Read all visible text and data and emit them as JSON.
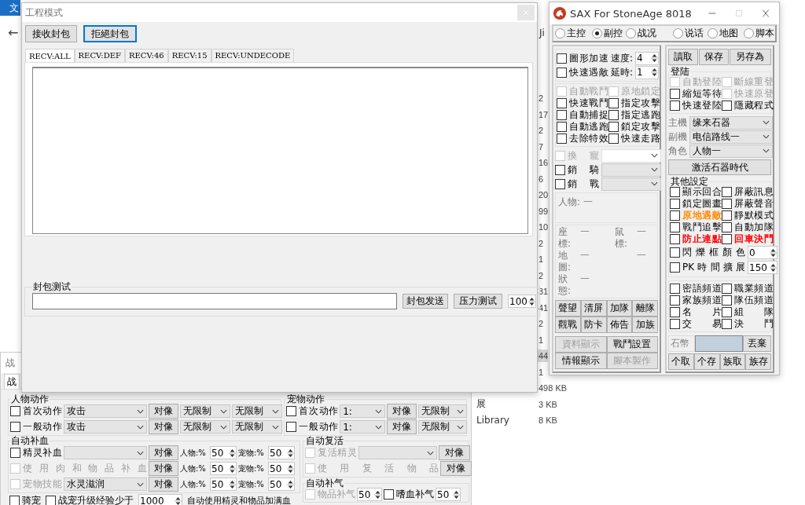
{
  "explorer": {
    "tab": "文",
    "back": "←",
    "column_head": "Ji",
    "rows": [
      {
        "size": "2",
        "selected": false
      },
      {
        "size": "17",
        "selected": false
      },
      {
        "size": "2",
        "selected": false
      },
      {
        "size": "7",
        "selected": false
      },
      {
        "size": "16",
        "selected": false
      },
      {
        "size": "6",
        "selected": false
      },
      {
        "size": "20",
        "selected": false
      },
      {
        "size": "99",
        "selected": false
      },
      {
        "size": "10",
        "selected": false
      },
      {
        "size": "2",
        "selected": false
      },
      {
        "size": "1",
        "selected": false
      },
      {
        "size": "2",
        "selected": false
      },
      {
        "size": "31",
        "selected": false
      },
      {
        "size": "41",
        "selected": false
      },
      {
        "size": "2",
        "selected": false
      },
      {
        "size": "1",
        "selected": false
      },
      {
        "size": "44",
        "selected": true
      },
      {
        "size": "1",
        "selected": false
      },
      {
        "size": "498 KB",
        "selected": false
      },
      {
        "name": "展",
        "size": "3 KB",
        "selected": false
      },
      {
        "name": "Library",
        "size": "8 KB",
        "selected": false
      }
    ]
  },
  "battle_window": {
    "title": "战",
    "tab": "战",
    "char_group": {
      "title": "人物动作",
      "rows": [
        {
          "label": "首次动作",
          "checked": false,
          "action": "攻击",
          "target": "对像",
          "limit_1": "无限制",
          "limit_2": "无限制"
        },
        {
          "label": "一般动作",
          "checked": false,
          "action": "攻击",
          "target": "对像",
          "limit_1": "无限制",
          "limit_2": "无限制"
        }
      ]
    },
    "pet_group": {
      "title": "宠物动作",
      "rows": [
        {
          "label": "首次动作",
          "checked": false,
          "action": "1:",
          "target": "对像",
          "limit": "无限制"
        },
        {
          "label": "一般动作",
          "checked": false,
          "action": "1:",
          "target": "对像",
          "limit": "无限制"
        }
      ]
    },
    "heal_group": {
      "title": "自动补血",
      "rows": [
        {
          "kind": "select",
          "label": "精灵补血",
          "checked": false,
          "disabled": false,
          "target": "对像",
          "char_label": "人物:%",
          "char_value": "50",
          "pet_label": "宠物:%",
          "pet_value": "50"
        },
        {
          "kind": "plain",
          "label": "使用肉和物品补血",
          "checked": false,
          "disabled": true,
          "target": "对像",
          "char_label": "人物:%",
          "char_value": "50",
          "pet_label": "宠物:%",
          "pet_value": "50"
        },
        {
          "kind": "select",
          "label": "宠物技能",
          "value": "水灵滋润",
          "checked": false,
          "disabled": true,
          "target": "对像",
          "char_label": "人物:%",
          "char_value": "50",
          "pet_label": "宠物:%",
          "pet_value": "50"
        }
      ]
    },
    "revive_group": {
      "title": "自动复活",
      "rows": [
        {
          "kind": "select",
          "label": "复活精灵",
          "checked": false,
          "disabled": true,
          "target": "对像"
        },
        {
          "kind": "plain",
          "label": "使用复活物品",
          "checked": false,
          "disabled": true,
          "target": "对像"
        }
      ]
    },
    "mp_group": {
      "title": "自动补气",
      "items": [
        {
          "label": "物品补气",
          "checked": false,
          "disabled": true,
          "value": "50"
        },
        {
          "label": "嗜血补气",
          "checked": false,
          "disabled": false,
          "value": "50"
        }
      ]
    },
    "ride": {
      "label": "骑宠",
      "checked": false
    },
    "exp": {
      "label": "战宠升级经验少于",
      "checked": false,
      "value": "1000",
      "note": "自动使用精灵和物品加满血"
    }
  },
  "packet_window": {
    "title": "工程模式",
    "buttons": [
      {
        "label": "接收封包",
        "focused": false
      },
      {
        "label": "拒絕封包",
        "focused": true
      }
    ],
    "tabs": [
      {
        "label": "RECV:ALL",
        "selected": true
      },
      {
        "label": "RECV:DEF",
        "selected": false
      },
      {
        "label": "RECV:46",
        "selected": false
      },
      {
        "label": "RECV:15",
        "selected": false
      },
      {
        "label": "RECV:UNDECODE",
        "selected": false
      }
    ],
    "test_group": {
      "title": "封包测试",
      "send_button": "封包发送",
      "stress_button": "压力测试",
      "count": "100"
    }
  },
  "sax_window": {
    "title": "SAX For StoneAge 8018",
    "modes": [
      {
        "label": "主控",
        "selected": false
      },
      {
        "label": "副控",
        "selected": true
      },
      {
        "label": "战况",
        "selected": false
      },
      {
        "label": "说话",
        "selected": false
      },
      {
        "label": "地图",
        "selected": false
      },
      {
        "label": "脚本",
        "selected": false
      }
    ],
    "speed_rows": [
      {
        "label": "圖形加速",
        "checked": false,
        "field_label": "速度:",
        "value": "4"
      },
      {
        "label": "快速遇敵",
        "checked": false,
        "field_label": "延時:",
        "value": "1"
      }
    ],
    "battle_options": [
      {
        "label": "自動戰鬥",
        "checked": false,
        "disabled": true
      },
      {
        "label": "原地鎖定",
        "checked": false,
        "disabled": true
      },
      {
        "label": "快速戰鬥",
        "checked": false,
        "disabled": false
      },
      {
        "label": "指定攻擊",
        "checked": false,
        "disabled": false
      },
      {
        "label": "自動捕捉",
        "checked": false,
        "disabled": false
      },
      {
        "label": "指定逃跑",
        "checked": false,
        "disabled": false
      },
      {
        "label": "自動逃跑",
        "checked": false,
        "disabled": false
      },
      {
        "label": "鎖定攻擊",
        "checked": false,
        "disabled": false
      },
      {
        "label": "去除特效",
        "checked": false,
        "disabled": false
      },
      {
        "label": "快速走路",
        "checked": false,
        "disabled": false
      }
    ],
    "pet_rows": [
      {
        "label": "換寵",
        "checked": false,
        "disabled": true
      },
      {
        "label": "銷騎",
        "checked": false,
        "disabled": false
      },
      {
        "label": "銷戰",
        "checked": false,
        "disabled": false
      }
    ],
    "info": "人物: 一",
    "status": {
      "coord_label": "座標:",
      "coord": "一",
      "mouse_label": "鼠標:",
      "mouse": "一",
      "map_label": "地圖:",
      "map": "一",
      "map_2": "一",
      "state_label": "狀態:",
      "state": "一"
    },
    "actions": [
      "聲望",
      "清屏",
      "加隊",
      "離隊",
      "觀戰",
      "防卡",
      "佈告",
      "加族"
    ],
    "panels": [
      {
        "label": "資料顯示",
        "disabled": true
      },
      {
        "label": "戰鬥設置",
        "disabled": false
      },
      {
        "label": "情報顯示",
        "disabled": false
      },
      {
        "label": "腳本製作",
        "disabled": true
      }
    ],
    "file_buttons": [
      "讀取",
      "保存",
      "另存為"
    ],
    "login": {
      "title": "登陆",
      "options": [
        {
          "label": "自動登陸",
          "checked": false,
          "disabled": true
        },
        {
          "label": "斷線重登",
          "checked": false,
          "disabled": true
        },
        {
          "label": "縮短等待",
          "checked": false,
          "disabled": false
        },
        {
          "label": "快速原登",
          "checked": false,
          "disabled": true
        },
        {
          "label": "快速登陸",
          "checked": false,
          "disabled": false
        },
        {
          "label": "隱藏程式",
          "checked": false,
          "disabled": false
        }
      ]
    },
    "servers": [
      {
        "label": "主機",
        "value": "缘来石器"
      },
      {
        "label": "副機",
        "value": "电信路线一"
      },
      {
        "label": "角色",
        "value": "人物一"
      }
    ],
    "activate_button": "激活石器時代",
    "other": {
      "title": "其他設定",
      "options": [
        {
          "label": "顯示回合",
          "checked": false
        },
        {
          "label": "屏蔽訊息",
          "checked": false
        },
        {
          "label": "鎖定圖畫",
          "checked": false
        },
        {
          "label": "屏蔽聲音",
          "checked": false
        },
        {
          "label": "原地遇敵",
          "checked": false,
          "color": "#ff8c00"
        },
        {
          "label": "靜默模式",
          "checked": false
        },
        {
          "label": "戰鬥追擊",
          "checked": false
        },
        {
          "label": "自動加隊",
          "checked": false
        },
        {
          "label": "防止連點",
          "checked": false,
          "color": "#ff0000"
        },
        {
          "label": "回車決鬥",
          "checked": false,
          "color": "#ff0000"
        }
      ]
    },
    "spins": [
      {
        "label": "閃爍框顏色",
        "checked": false,
        "value": "0"
      },
      {
        "label": "PK時間擴展",
        "checked": false,
        "value": "150"
      }
    ],
    "channels": [
      {
        "label": "密語頻道",
        "checked": false
      },
      {
        "label": "職業頻道",
        "checked": false
      },
      {
        "label": "家族頻道",
        "checked": false
      },
      {
        "label": "隊伍頻道",
        "checked": false
      },
      {
        "label": "名　　片",
        "checked": false
      },
      {
        "label": "組　　隊",
        "checked": false
      },
      {
        "label": "交　　易",
        "checked": false
      },
      {
        "label": "決　　鬥",
        "checked": false
      }
    ],
    "coin_label": "石幣",
    "discard_button": "丟棄",
    "bank_buttons": [
      "个取",
      "个存",
      "族取",
      "族存"
    ]
  }
}
